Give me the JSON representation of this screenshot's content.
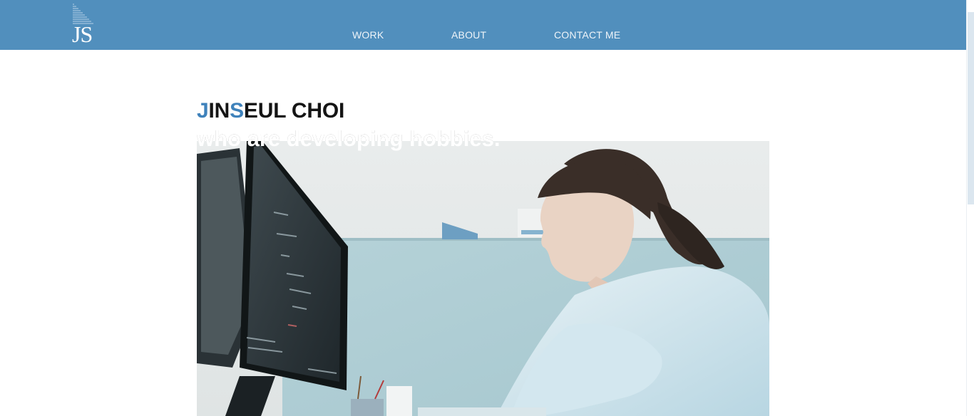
{
  "header": {
    "logo_text": "JS",
    "nav": [
      {
        "label": "WORK"
      },
      {
        "label": "ABOUT"
      },
      {
        "label": "CONTACT ME"
      }
    ]
  },
  "hero": {
    "title_parts": [
      "J",
      "IN",
      "S",
      "EUL CHOI"
    ],
    "tagline": "who are developing hobbies.",
    "photo_alt": "Person working at a computer monitor in an office cubicle"
  },
  "colors": {
    "header_bg": "#518fbd",
    "accent": "#3f82bb",
    "text": "#141414"
  }
}
